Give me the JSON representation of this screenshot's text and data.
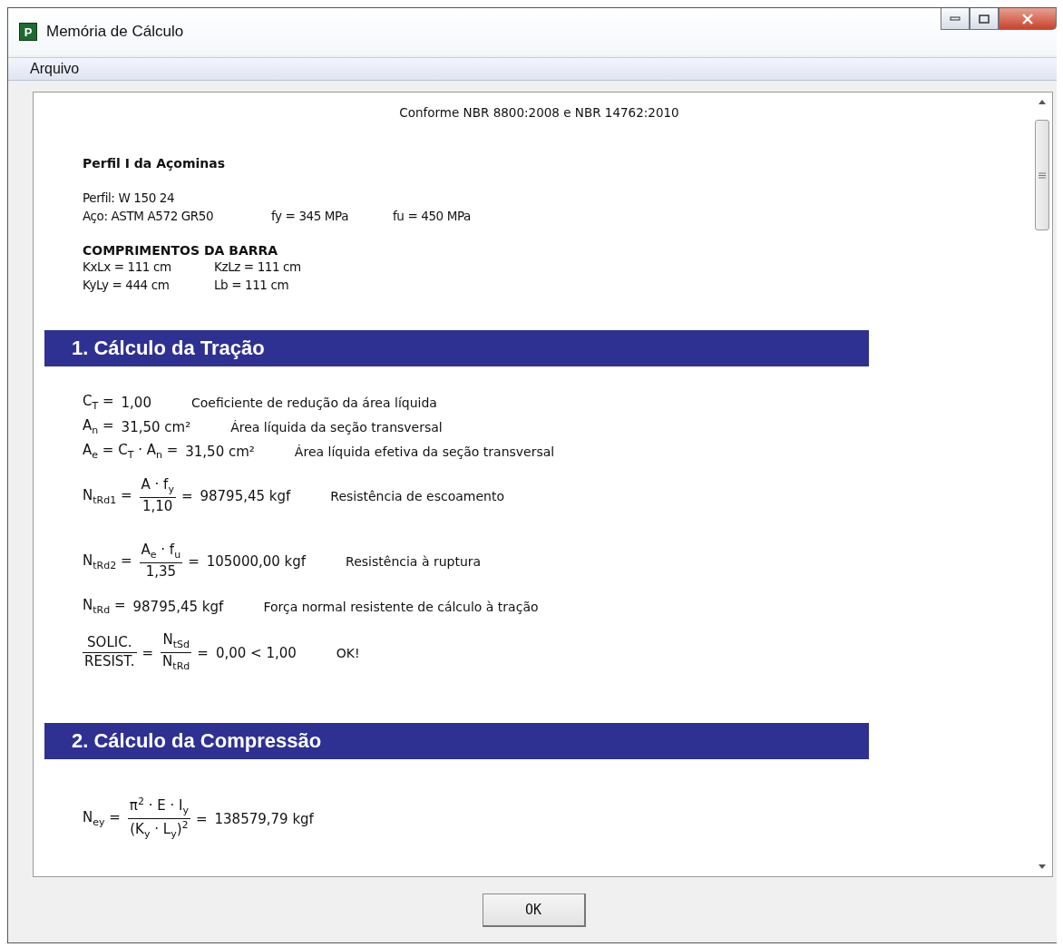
{
  "window": {
    "app_icon": "P",
    "title": "Memória de Cálculo"
  },
  "menu": [
    "Arquivo"
  ],
  "document": {
    "norm": "Conforme NBR 8800:2008 e NBR 14762:2010",
    "profile_title": "Perfil I da Açominas",
    "profile_lines": [
      [
        "Perfil: W 150 24"
      ],
      [
        "Aço: ASTM A572 GR50",
        "fy = 345 MPa",
        "fu = 450 MPa"
      ]
    ],
    "lengths_title": "COMPRIMENTOS DA BARRA",
    "lengths": [
      [
        "KxLx = 111 cm",
        "KzLz = 111 cm"
      ],
      [
        "KyLy = 444 cm",
        "Lb = 111 cm"
      ]
    ],
    "sections": [
      {
        "title": "1. Cálculo da Tração",
        "formulas": [
          {
            "parts": [
              {
                "kind": "text",
                "text": "C$_{T}$ ="
              },
              {
                "kind": "text",
                "text": "1,00"
              }
            ],
            "description": "Coeficiente de redução da área líquida"
          },
          {
            "parts": [
              {
                "kind": "text",
                "text": "A$_{n}$ ="
              },
              {
                "kind": "text",
                "text": "31,50  cm²"
              }
            ],
            "description": "Área líquida da seção transversal"
          },
          {
            "parts": [
              {
                "kind": "text",
                "text": "A$_{e}$ = C$_{T}$ · A$_{n}$ ="
              },
              {
                "kind": "text",
                "text": "31,50  cm²"
              }
            ],
            "description": "Área líquida efetiva da seção transversal"
          },
          {
            "parts": [
              {
                "kind": "text",
                "text": "N$_{tRd1}$ ="
              },
              {
                "kind": "fraction",
                "numerator": "A · f$_{y}$",
                "denominator": "1,10"
              },
              {
                "kind": "text",
                "text": "="
              },
              {
                "kind": "text",
                "text": "98795,45  kgf"
              }
            ],
            "description": "Resistência de escoamento"
          },
          {
            "parts": [
              {
                "kind": "text",
                "text": "N$_{tRd2}$ ="
              },
              {
                "kind": "fraction",
                "numerator": "A$_{e}$ · f$_{u}$",
                "denominator": "1,35"
              },
              {
                "kind": "text",
                "text": "="
              },
              {
                "kind": "text",
                "text": "105000,00  kgf"
              }
            ],
            "description": "Resistência à ruptura"
          },
          {
            "parts": [
              {
                "kind": "text",
                "text": "N$_{tRd}$ ="
              },
              {
                "kind": "text",
                "text": "98795,45  kgf"
              }
            ],
            "description": "Força normal resistente de cálculo à tração"
          },
          {
            "parts": [
              {
                "kind": "fraction",
                "numerator": "SOLIC.",
                "denominator": "RESIST."
              },
              {
                "kind": "text",
                "text": "="
              },
              {
                "kind": "fraction",
                "numerator": "N$_{tSd}$",
                "denominator": "N$_{tRd}$"
              },
              {
                "kind": "text",
                "text": "="
              },
              {
                "kind": "text",
                "text": "0,00  < 1,00"
              }
            ],
            "description": "OK!"
          }
        ]
      },
      {
        "title": "2. Cálculo da Compressão",
        "formulas": [
          {
            "parts": [
              {
                "kind": "text",
                "text": "N$_{ey}$ ="
              },
              {
                "kind": "fraction",
                "numerator": "π$^{2}$ · E · I$_{y}$",
                "denominator": "(K$_{y}$ · L$_{y}$)$^{2}$"
              },
              {
                "kind": "text",
                "text": "="
              },
              {
                "kind": "text",
                "text": "138579,79  kgf"
              }
            ]
          }
        ]
      }
    ]
  },
  "buttons": [
    "OK"
  ]
}
